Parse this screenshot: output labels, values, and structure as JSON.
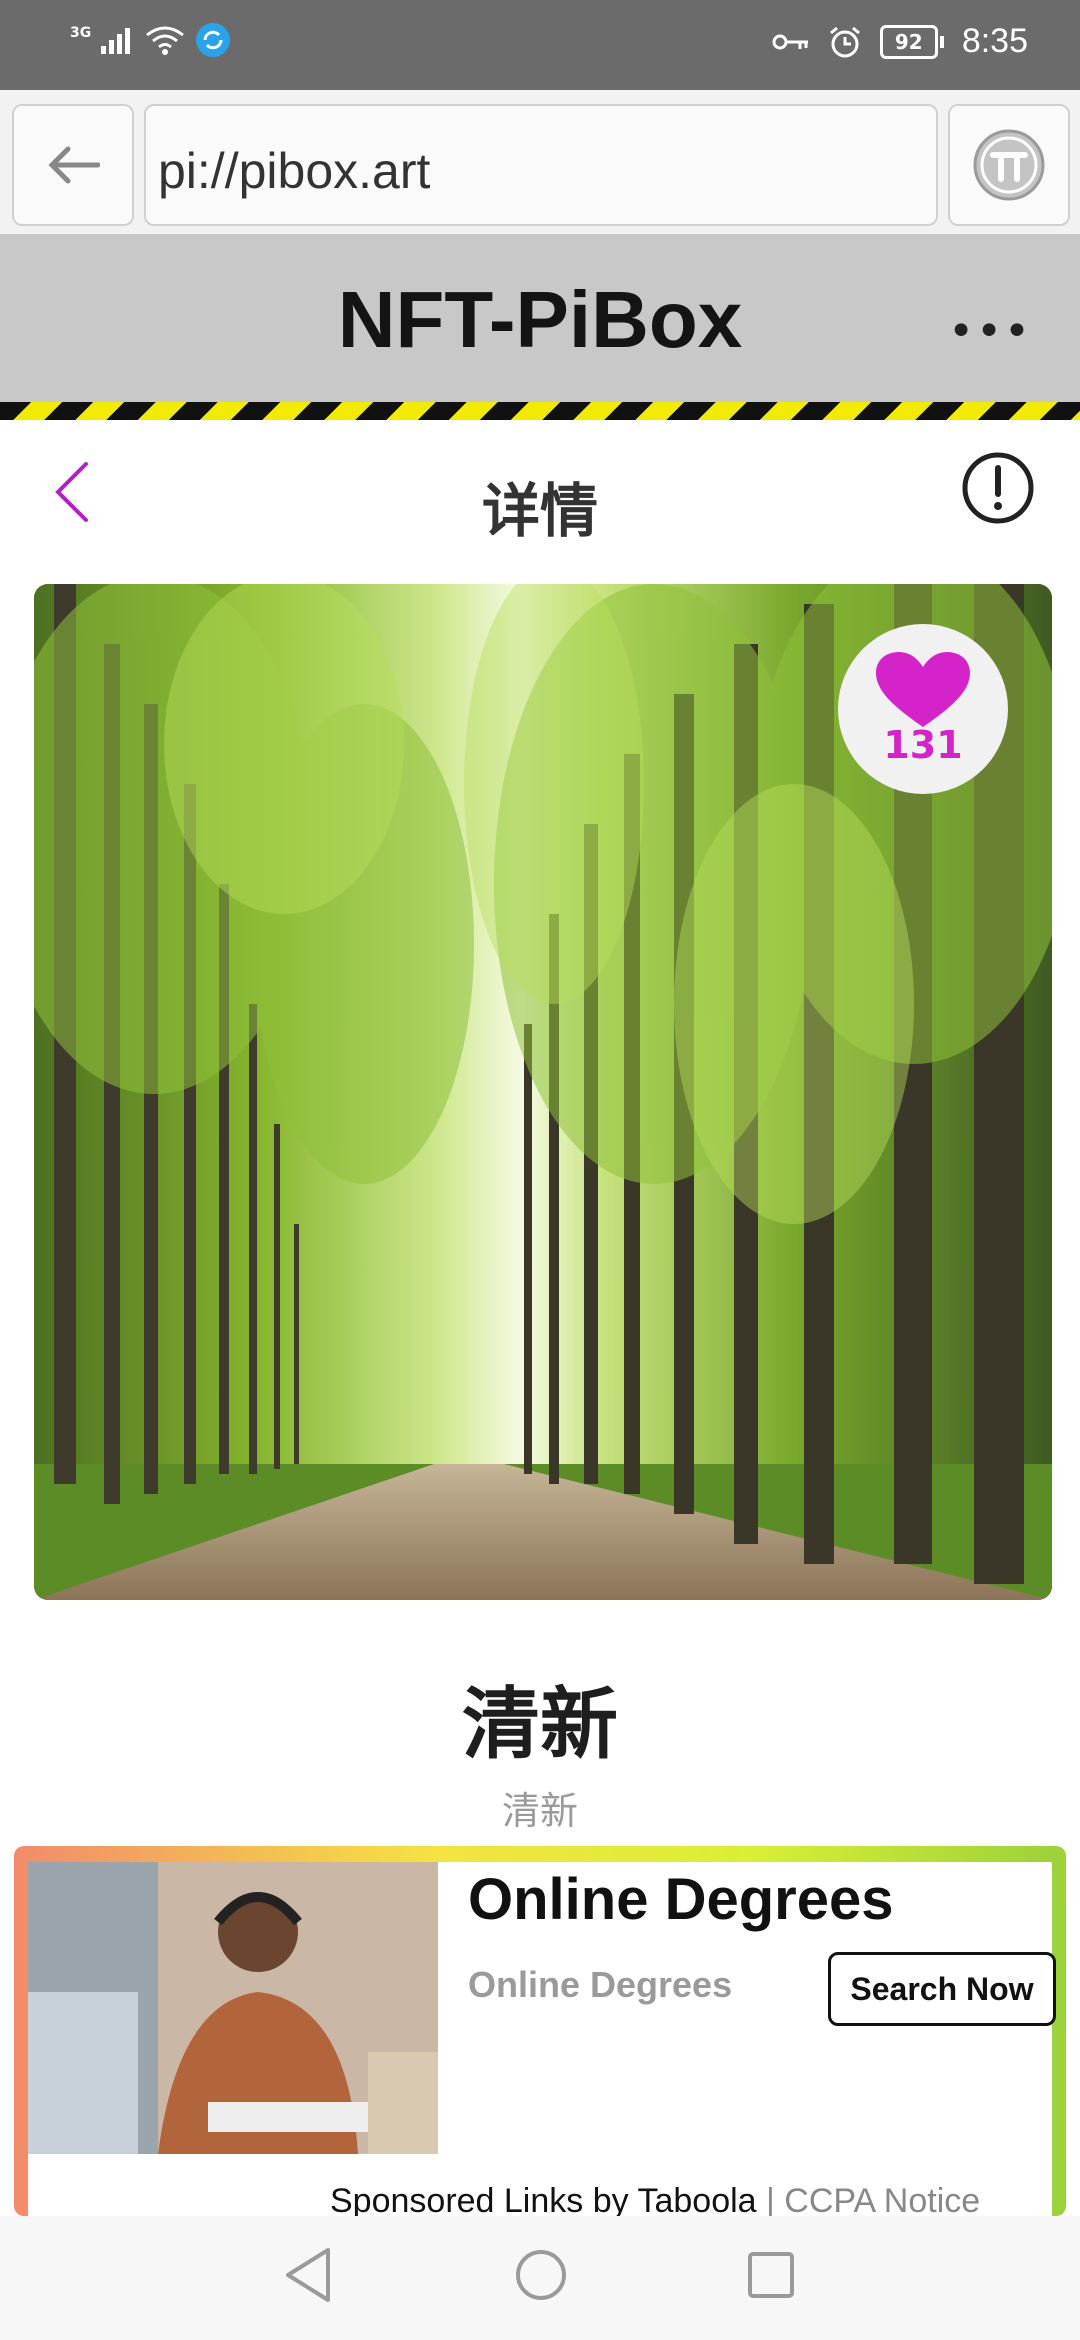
{
  "status_bar": {
    "network": "3G",
    "battery": "92",
    "time": "8:35"
  },
  "browser": {
    "url": "pi://pibox.art",
    "back_icon": "arrow-left-icon",
    "pi_icon": "pi-logo-icon"
  },
  "site": {
    "title": "NFT-PiBox",
    "more_icon": "more-icon"
  },
  "detail": {
    "title": "详情"
  },
  "artwork": {
    "likes": "131",
    "heart_color": "#d323c9"
  },
  "nft": {
    "title": "清新",
    "subtitle": "清新"
  },
  "ad": {
    "title": "Online Degrees",
    "subtitle": "Online Degrees",
    "button": "Search Now",
    "sponsor": "Sponsored Links by Taboola",
    "separator": " | ",
    "ccpa": "CCPA Notice"
  },
  "colors": {
    "accent": "#b21fc4",
    "header_bg": "#c8c8c8",
    "stripe_yellow": "#f2ea00"
  }
}
